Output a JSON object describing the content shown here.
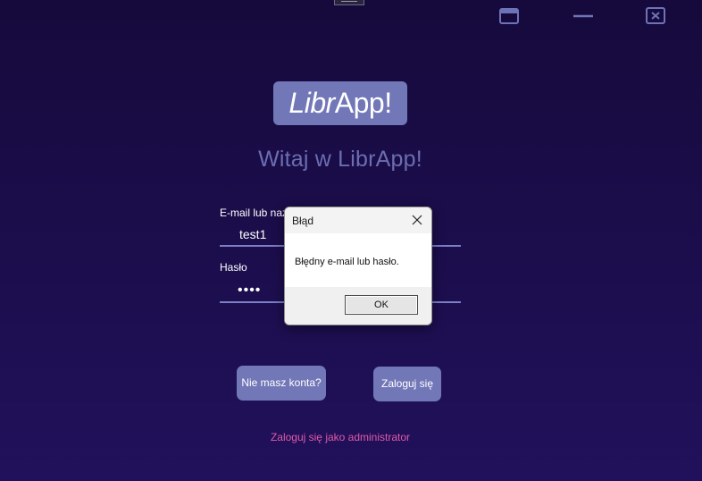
{
  "window": {
    "controls": {
      "maximize_icon": "window-icon",
      "minimize_icon": "minimize-icon",
      "close_icon": "close-box-icon",
      "color": "#6e73b8"
    }
  },
  "logo": {
    "italic_part": "Libr",
    "bold_part": "App!",
    "background": "#7277b8"
  },
  "welcome_text": "Witaj w LibrApp!",
  "form": {
    "email_label": "E-mail lub naz",
    "email_value": "test1",
    "password_label": "Hasło",
    "password_value": "••••"
  },
  "buttons": {
    "signup": "Nie masz konta?",
    "login": "Zaloguj się"
  },
  "admin_link": "Zaloguj się jako administrator",
  "dialog": {
    "title": "Błąd",
    "message": "Błędny e-mail lub hasło.",
    "ok_label": "OK",
    "close_icon": "close-icon"
  },
  "colors": {
    "accent": "#7277b8",
    "link": "#e05aa6",
    "background_top": "#160a3c",
    "background_bottom": "#21115c"
  }
}
